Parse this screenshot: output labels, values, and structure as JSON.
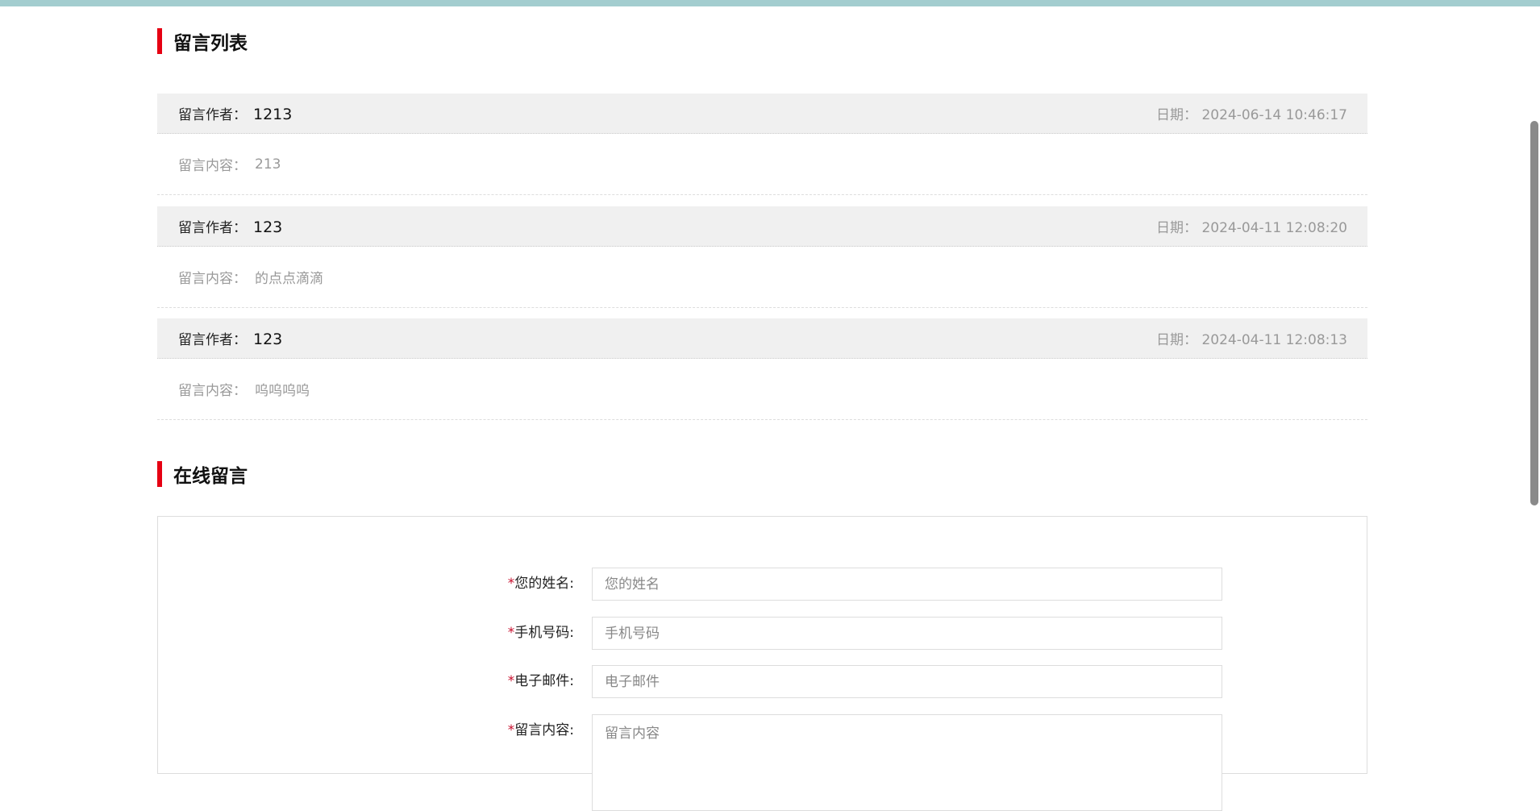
{
  "list_section": {
    "title": "留言列表"
  },
  "messages": [
    {
      "author_label": "留言作者：",
      "author": "1213",
      "date_label": "日期：",
      "date": "2024-06-14 10:46:17",
      "content_label": "留言内容：",
      "content": "213"
    },
    {
      "author_label": "留言作者：",
      "author": "123",
      "date_label": "日期：",
      "date": "2024-04-11 12:08:20",
      "content_label": "留言内容：",
      "content": "的点点滴滴"
    },
    {
      "author_label": "留言作者：",
      "author": "123",
      "date_label": "日期：",
      "date": "2024-04-11 12:08:13",
      "content_label": "留言内容：",
      "content": "呜呜呜呜"
    }
  ],
  "form_section": {
    "title": "在线留言"
  },
  "form": {
    "required_mark": "*",
    "name": {
      "label": "您的姓名:",
      "placeholder": "您的姓名"
    },
    "phone": {
      "label": "手机号码:",
      "placeholder": "手机号码"
    },
    "email": {
      "label": "电子邮件:",
      "placeholder": "电子邮件"
    },
    "content": {
      "label": "留言内容:",
      "placeholder": "留言内容"
    }
  },
  "colors": {
    "accent": "#e60012",
    "topbar": "#a3cdcf"
  }
}
